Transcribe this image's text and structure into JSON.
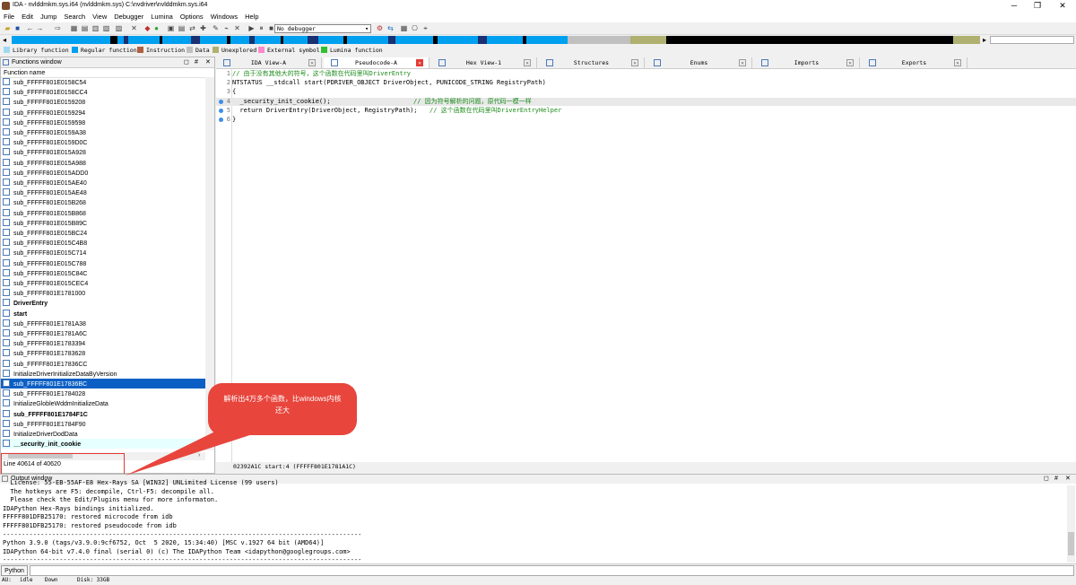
{
  "window": {
    "title": "IDA - nvlddmkm.sys.i64 (nvlddmkm.sys) C:\\nvdriver\\nvlddmkm.sys.i64",
    "min": "─",
    "max": "❐",
    "close": "✕"
  },
  "menu": [
    "File",
    "Edit",
    "Jump",
    "Search",
    "View",
    "Debugger",
    "Lumina",
    "Options",
    "Windows",
    "Help"
  ],
  "toolbar": {
    "debugger": "No debugger"
  },
  "legend": [
    {
      "label": "Library function",
      "color": "#a0d8f0"
    },
    {
      "label": "Regular function",
      "color": "#00a0f0"
    },
    {
      "label": "Instruction",
      "color": "#b06040"
    },
    {
      "label": "Data",
      "color": "#c0c0c0"
    },
    {
      "label": "Unexplored",
      "color": "#b0b070"
    },
    {
      "label": "External symbol",
      "color": "#ff88cc"
    },
    {
      "label": "Lumina function",
      "color": "#30c030"
    }
  ],
  "functions": {
    "title": "Functions window",
    "column": "Function name",
    "items": [
      {
        "name": "sub_FFFFF801E0158C54"
      },
      {
        "name": "sub_FFFFF801E0158CC4"
      },
      {
        "name": "sub_FFFFF801E0159208"
      },
      {
        "name": "sub_FFFFF801E0159294"
      },
      {
        "name": "sub_FFFFF801E0159598"
      },
      {
        "name": "sub_FFFFF801E0159A38"
      },
      {
        "name": "sub_FFFFF801E0159D0C"
      },
      {
        "name": "sub_FFFFF801E015A928"
      },
      {
        "name": "sub_FFFFF801E015A988"
      },
      {
        "name": "sub_FFFFF801E015ADD0"
      },
      {
        "name": "sub_FFFFF801E015AE40"
      },
      {
        "name": "sub_FFFFF801E015AE48"
      },
      {
        "name": "sub_FFFFF801E015B268"
      },
      {
        "name": "sub_FFFFF801E015B868"
      },
      {
        "name": "sub_FFFFF801E015B89C"
      },
      {
        "name": "sub_FFFFF801E015BC24"
      },
      {
        "name": "sub_FFFFF801E015C4B8"
      },
      {
        "name": "sub_FFFFF801E015C714"
      },
      {
        "name": "sub_FFFFF801E015C788"
      },
      {
        "name": "sub_FFFFF801E015C84C"
      },
      {
        "name": "sub_FFFFF801E015CEC4"
      },
      {
        "name": "sub_FFFFF801E1781000"
      },
      {
        "name": "DriverEntry",
        "bold": true
      },
      {
        "name": "start",
        "bold": true
      },
      {
        "name": "sub_FFFFF801E1781A38"
      },
      {
        "name": "sub_FFFFF801E1781A6C"
      },
      {
        "name": "sub_FFFFF801E1783394"
      },
      {
        "name": "sub_FFFFF801E1783628"
      },
      {
        "name": "sub_FFFFF801E17836CC"
      },
      {
        "name": "InitializeDriverInitializeDataByVersion"
      },
      {
        "name": "sub_FFFFF801E17836BC",
        "selected": true
      },
      {
        "name": "sub_FFFFF801E1784028"
      },
      {
        "name": "InitializeGlobleWddmInitializeData"
      },
      {
        "name": "sub_FFFFF801E1784F1C",
        "bold": true
      },
      {
        "name": "sub_FFFFF801E1784F90"
      },
      {
        "name": "InitializeDriverDodData"
      },
      {
        "name": "__security_init_cookie",
        "bold": true,
        "cyan": true
      }
    ],
    "line_count": "Line 40614 of 40620"
  },
  "tabs": [
    {
      "label": "IDA View-A"
    },
    {
      "label": "Pseudocode-A",
      "active": true
    },
    {
      "label": "Hex View-1"
    },
    {
      "label": "Structures"
    },
    {
      "label": "Enums"
    },
    {
      "label": "Imports"
    },
    {
      "label": "Exports"
    }
  ],
  "code": {
    "lines": [
      {
        "n": "1",
        "text": "// 由于没有其他大的符号，这个函数在代码里叫DriverEntry"
      },
      {
        "n": "2",
        "text": "NTSTATUS __stdcall start(PDRIVER_OBJECT DriverObject, PUNICODE_STRING RegistryPath)"
      },
      {
        "n": "3",
        "text": "{"
      },
      {
        "n": "4",
        "text": "  _security_init_cookie();",
        "comment": "// 因为符号解析的问题，原代码一模一样"
      },
      {
        "n": "5",
        "text": "  return DriverEntry(DriverObject, RegistryPath);",
        "comment": "// 这个函数在代码里叫DriverEntryHelper"
      },
      {
        "n": "6",
        "text": "}"
      }
    ],
    "status": "02392A1C start:4 (FFFFF801E1781A1C)"
  },
  "output": {
    "title": "Output window",
    "lines": [
      "  License: 55-EB-55AF-E8 Hex-Rays SA [WIN32] UNLimited License (99 users)",
      "  The hotkeys are F5: decompile, Ctrl-F5: decompile all.",
      "  Please check the Edit/Plugins menu for more informaton.",
      "IDAPython Hex-Rays bindings initialized.",
      "FFFFF801DFB25170: restored microcode from idb",
      "FFFFF801DFB25170: restored pseudocode from idb",
      "-----------------------------------------------------------------------------------------------",
      "Python 3.9.0 (tags/v3.9.0:9cf6752, Oct  5 2020, 15:34:40) [MSC v.1927 64 bit (AMD64)]",
      "IDAPython 64-bit v7.4.0 final (serial 0) (c) The IDAPython Team <idapython@googlegroups.com>",
      "-----------------------------------------------------------------------------------------------"
    ]
  },
  "python_button": "Python",
  "status": {
    "au": "AU:",
    "idle": "idle",
    "dir": "Down",
    "disk": "Disk: 33GB"
  },
  "callout": {
    "text": "解析出4万多个函数，比windows内核还大"
  }
}
